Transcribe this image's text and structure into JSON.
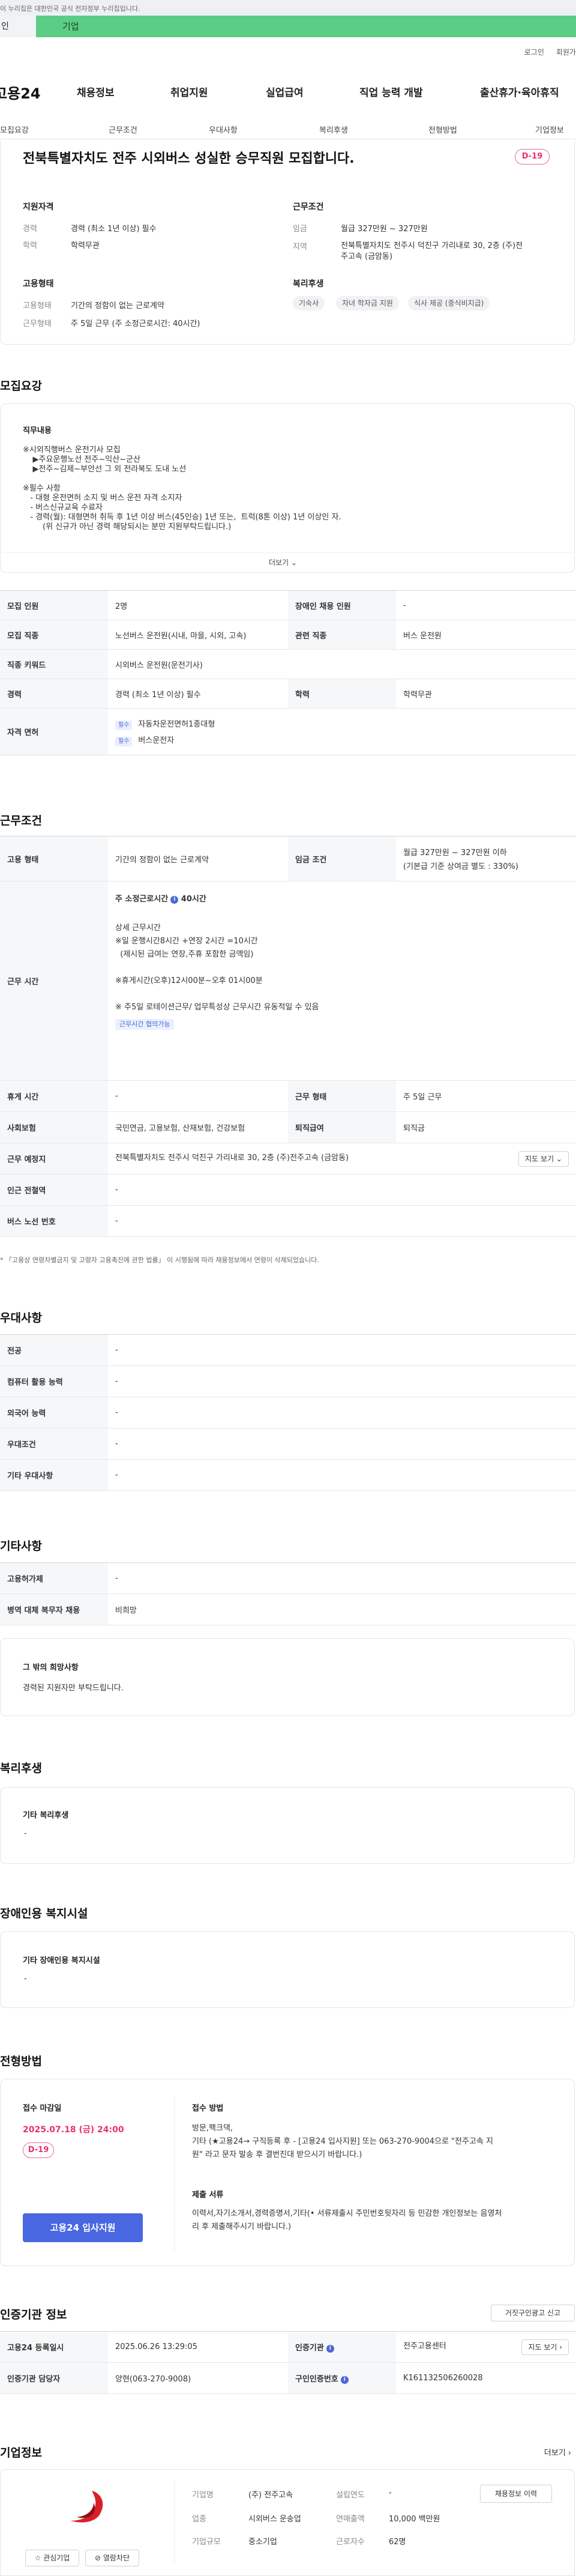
{
  "gov_bar": "이 누리집은 대한민국 공식 전자정부 누리집입니다.",
  "site_tabs": {
    "tab1": "인",
    "tab2": "기업"
  },
  "util": {
    "login": "로그인",
    "signup": "회원가"
  },
  "gnb": {
    "logo": "고용24",
    "menu": [
      "채용정보",
      "취업지원",
      "실업급여",
      "직업 능력 개발",
      "출산휴가·육아휴직"
    ]
  },
  "subnav": [
    "모집요강",
    "근무조건",
    "우대사항",
    "복리후생",
    "전형방법",
    "기업정보"
  ],
  "header": {
    "title": "전북특별자치도 전주 시외버스 성실한 승무직원 모집합니다.",
    "dday": "D-19",
    "qualification": {
      "heading": "지원자격",
      "career_label": "경력",
      "career_value": "경력 (최소 1년 이상) 필수",
      "edu_label": "학력",
      "edu_value": "학력무관"
    },
    "conditions": {
      "heading": "근무조건",
      "wage_label": "임금",
      "wage_value": "월급 327만원 ~ 327만원",
      "region_label": "지역",
      "region_value_1": "전북특별자치도 전주시 덕진구 가리내로 30, 2층 (주)전",
      "region_value_2": "주고속 (금암동)"
    },
    "employment": {
      "heading": "고용형태",
      "type_label": "고용형태",
      "type_value": "기간의 정함이 없는 근로계약",
      "hours_label": "근무형태",
      "hours_value": "주 5일 근무 (주 소정근로시간: 40시간)"
    },
    "benefits": {
      "heading": "복리후생",
      "tags": [
        "기숙사",
        "자녀 학자금 지원",
        "식사 제공 (중식비지급)"
      ]
    }
  },
  "recruit": {
    "section_title": "모집요강",
    "job_heading": "직무내용",
    "job_text": "※시외직행버스 운전기사 모집\n    ▶주요운행노선 전주~익산~군산\n    ▶전주~김제~부안선 그 외 전라북도 도내 노선\n\n※필수 사항\n   - 대형 운전면허 소지 및 버스 운전 자격 소지자\n   - 버스신규교육 수료자\n   - 경력(월): 대형면허 취득 후 1년 이상 버스(45인승) 1년 또는,  트럭(8톤 이상) 1년 이상인 자.\n        (위 신규가 아닌 경력 해당되시는 분만 지원부탁드립니다.)",
    "more": "더보기",
    "rows": {
      "count_label": "모집 인원",
      "count_value": "2명",
      "disabled_label": "장애인 채용 인원",
      "disabled_value": "-",
      "job_label": "모집 직종",
      "job_value": "노선버스 운전원(시내, 마을, 시외, 고속)",
      "related_label": "관련 직종",
      "related_value": "버스 운전원",
      "keyword_label": "직종 키워드",
      "keyword_value": "시외버스 운전원(운전기사)",
      "career_label": "경력",
      "career_value": "경력 (최소 1년 이상) 필수",
      "edu_label": "학력",
      "edu_value": "학력무관",
      "license_label": "자격 면허",
      "licenses": [
        {
          "badge": "필수",
          "name": "자동차운전면허1종대형"
        },
        {
          "badge": "필수",
          "name": "버스운전자"
        }
      ]
    }
  },
  "work": {
    "section_title": "근무조건",
    "type_label": "고용 형태",
    "type_value": "기간의 정함이 없는 근로계약",
    "wage_label": "임금 조건",
    "wage_value": "월급 327만원 ~ 327만원 이하",
    "wage_sub": "(기본급 기준 상여금 별도 : 330%)",
    "time_label": "근무 시간",
    "time_title": "주 소정근로시간",
    "time_hours": "40시간",
    "time_detail": "상세 근무시간\n※일 운행시간8시간 +연장 2시간 =10시간\n  (제시된 급여는 연장,주휴 포함한 금액임)\n\n※휴게시간(오후)12시00분~오후 01시00분\n\n※ 주5일 로테이션근무/ 업무특성상 근무시간 유동적일 수 있음",
    "time_tag": "근무시간 협의가능",
    "rest_label": "휴게 시간",
    "rest_value": "-",
    "shift_label": "근무 형태",
    "shift_value": "주 5일 근무",
    "ins_label": "사회보험",
    "ins_value": "국민연금, 고용보험, 산재보험, 건강보험",
    "retire_label": "퇴직급여",
    "retire_value": "퇴직금",
    "place_label": "근무 예정지",
    "place_value": "전북특별자치도 전주시 덕진구 가리내로 30, 2층 (주)전주고속 (금암동)",
    "map_btn": "지도 보기 ⌄",
    "subway_label": "인근 전철역",
    "subway_value": "-",
    "bus_label": "버스 노선 번호",
    "bus_value": "-",
    "note": "* 「고용상 연령차별금지 및 고령자 고용촉진에 관한 법률」 이 시행됨에 따라 채용정보에서 연령이 삭제되었습니다."
  },
  "pref": {
    "section_title": "우대사항",
    "rows": [
      {
        "label": "전공",
        "value": "-"
      },
      {
        "label": "컴퓨터 활용 능력",
        "value": "-"
      },
      {
        "label": "외국어 능력",
        "value": "-"
      },
      {
        "label": "우대조건",
        "value": "-"
      },
      {
        "label": "기타 우대사항",
        "value": "-"
      }
    ]
  },
  "etc": {
    "section_title": "기타사항",
    "rows": [
      {
        "label": "고용허가제",
        "value": "-"
      },
      {
        "label": "병역 대체 복무자 채용",
        "value": "비희망"
      }
    ],
    "wish_title": "그 밖의 희망사항",
    "wish_text": "경력된 지원자만 부탁드립니다."
  },
  "welfare": {
    "section_title": "복리후생",
    "box_title": "기타 복리후생",
    "box_value": "-"
  },
  "disabled": {
    "section_title": "장애인용 복지시설",
    "box_title": "기타 장애인용 복지시설",
    "box_value": "-"
  },
  "apply": {
    "section_title": "전형방법",
    "deadline_label": "접수 마감일",
    "deadline": "2025.07.18 (금) 24:00",
    "dday": "D-19",
    "btn": "고용24 입사지원",
    "method_title": "접수 방법",
    "method_text": "방문,팩크댁,\n기타 (★고용24→ 구직등록 후 - [고용24 입사지원] 또는 063-270-9004으로 \"전주고속 지\n원\" 라고 문자 발송 후 결번진대 받으시기 바랍니다.)",
    "docs_title": "제출 서류",
    "docs_text": "이력서,자기소개서,경력증명서,기타(• 서류제출시 주민번호뒷자리 등 민감한 개인정보는 음영처\n리 후 제출해주시기 바랍니다.)"
  },
  "cert": {
    "section_title": "인증기관 정보",
    "report_btn": "거짓구인광고 신고",
    "reg_label": "고용24 등록일시",
    "reg_value": "2025.06.26 13:29:05",
    "agency_label": "인증기관",
    "agency_value": "전주고용센터",
    "map_btn": "지도 보기 ›",
    "manager_label": "인증기관 담당자",
    "manager_value": "양현(063-270-9008)",
    "id_label": "구인인증번호",
    "id_value": "K161132506260028"
  },
  "company": {
    "section_title": "기업정보",
    "more": "더보기 ›",
    "fav_btn": "☆ 관심기업",
    "block_btn": "⊘ 열람차단",
    "name_label": "기업명",
    "name_value": "(주) 전주고속",
    "year_label": "설립연도",
    "year_value": "-",
    "hist_btn": "채용정보 이력",
    "biz_label": "업종",
    "biz_value": "시외버스 운송업",
    "sales_label": "연매출액",
    "sales_value": "10,000 백만원",
    "size_label": "기업규모",
    "size_value": "중소기업",
    "emp_label": "근로자수",
    "emp_value": "62명"
  },
  "colors": {
    "accent": "#4867e0",
    "brand_green": "#5ccd84",
    "dday_pink": "#e8336b"
  }
}
